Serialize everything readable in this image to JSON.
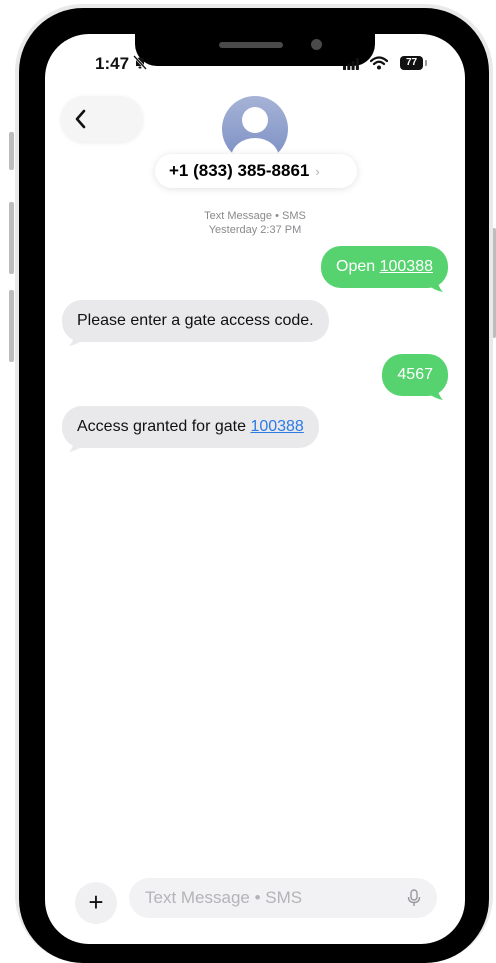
{
  "status_bar": {
    "time": "1:47",
    "battery": "77",
    "silent_icon": "bell-slash-icon",
    "signal_icon": "cellular-signal-icon",
    "wifi_icon": "wifi-icon"
  },
  "header": {
    "back_icon": "chevron-left-icon",
    "avatar_icon": "person-avatar-icon",
    "contact": "+1 (833) 385-8861",
    "contact_chevron": "›"
  },
  "thread_meta": {
    "line1": "Text Message • SMS",
    "line2": "Yesterday 2:37 PM"
  },
  "messages": [
    {
      "direction": "outgoing",
      "text": "Open ",
      "link": "100388"
    },
    {
      "direction": "incoming",
      "text": "Please enter a gate access code."
    },
    {
      "direction": "outgoing",
      "text": "4567"
    },
    {
      "direction": "incoming",
      "text": "Access granted for gate ",
      "link": "100388"
    }
  ],
  "composer": {
    "plus": "+",
    "placeholder": "Text Message • SMS",
    "mic_icon": "microphone-icon"
  },
  "colors": {
    "outgoing_bubble": "#56d26f",
    "incoming_bubble": "#e9e9eb",
    "link_blue": "#2c7be5"
  }
}
